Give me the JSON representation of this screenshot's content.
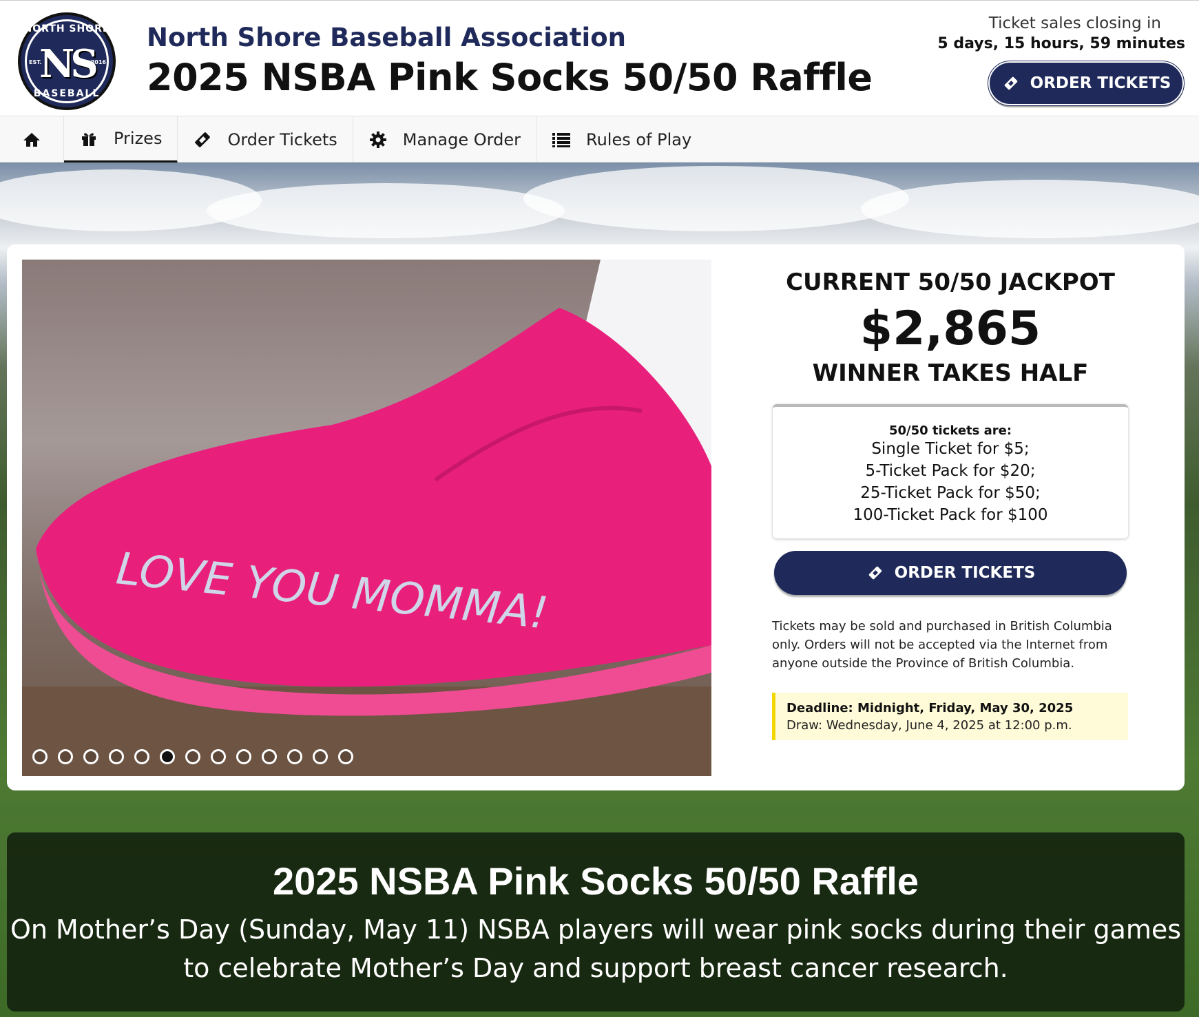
{
  "header": {
    "logo": {
      "top_text": "NORTH SHORE",
      "monogram": "NS",
      "est": "EST.",
      "year": "2016",
      "bottom_text": "BASEBALL"
    },
    "organization": "North Shore Baseball Association",
    "title": "2025 NSBA Pink Socks 50/50 Raffle",
    "closing_label": "Ticket sales closing in",
    "closing_time": "5 days, 15 hours, 59 minutes",
    "order_button": "ORDER TICKETS"
  },
  "nav": {
    "items": [
      {
        "label": "",
        "icon": "home-icon"
      },
      {
        "label": "Prizes",
        "icon": "gift-icon"
      },
      {
        "label": "Order Tickets",
        "icon": "ticket-icon"
      },
      {
        "label": "Manage Order",
        "icon": "gear-icon"
      },
      {
        "label": "Rules of Play",
        "icon": "list-icon"
      }
    ],
    "active": "Prizes"
  },
  "carousel": {
    "image_text": "LOVE YOU MOMMA!",
    "slide_count": 13,
    "active_index": 5
  },
  "jackpot": {
    "label": "CURRENT 50/50 JACKPOT",
    "amount": "$2,865",
    "note": "WINNER TAKES HALF"
  },
  "pricing": {
    "heading": "50/50 tickets are:",
    "lines": [
      "Single Ticket for $5;",
      "5-Ticket Pack for $20;",
      "25-Ticket Pack for $50;",
      "100-Ticket Pack for $100"
    ]
  },
  "order_button": "ORDER TICKETS",
  "legal": "Tickets may be sold and purchased in British Columbia only. Orders will not be accepted via the Internet from anyone outside the Province of British Columbia.",
  "deadline": {
    "deadline_text": "Deadline: Midnight, Friday, May 30, 2025",
    "draw_text": "Draw: Wednesday, June 4, 2025 at 12:00 p.m."
  },
  "banner": {
    "title": "2025 NSBA Pink Socks 50/50 Raffle",
    "text": "On Mother’s Day (Sunday, May 11) NSBA players will wear pink socks during their games to celebrate Mother’s Day and support breast cancer research."
  },
  "colors": {
    "navy": "#1f2a5a",
    "pink": "#e8207c",
    "deadline_bg": "#fffbd8",
    "deadline_bar": "#f2d600"
  }
}
